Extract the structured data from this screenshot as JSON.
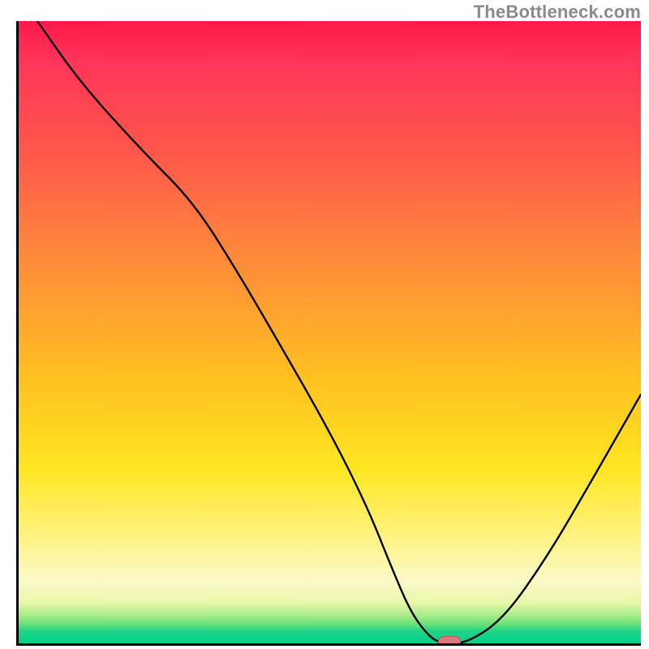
{
  "watermark": "TheBottleneck.com",
  "chart_data": {
    "type": "line",
    "title": "",
    "xlabel": "",
    "ylabel": "",
    "xlim": [
      0,
      100
    ],
    "ylim": [
      0,
      100
    ],
    "grid": false,
    "legend": false,
    "background": "red-to-green vertical gradient",
    "series": [
      {
        "name": "bottleneck-curve",
        "x": [
          3,
          10,
          20,
          28,
          35,
          42,
          50,
          56,
          60,
          63,
          66,
          68,
          72,
          78,
          85,
          92,
          100
        ],
        "y": [
          100,
          90,
          79,
          71,
          60,
          48,
          34,
          22,
          12,
          5,
          1,
          0,
          0,
          4,
          14,
          26,
          40
        ]
      }
    ],
    "marker": {
      "x": 69,
      "y": 0.7,
      "shape": "pill",
      "color": "#d97a7a"
    },
    "gradient_stops": [
      {
        "pct": 0,
        "color": "#ff1a4a"
      },
      {
        "pct": 22,
        "color": "#ff5a4a"
      },
      {
        "pct": 58,
        "color": "#ffc220"
      },
      {
        "pct": 82,
        "color": "#fff27a"
      },
      {
        "pct": 95.5,
        "color": "#a9ec8a"
      },
      {
        "pct": 100,
        "color": "#00cf8e"
      }
    ]
  }
}
